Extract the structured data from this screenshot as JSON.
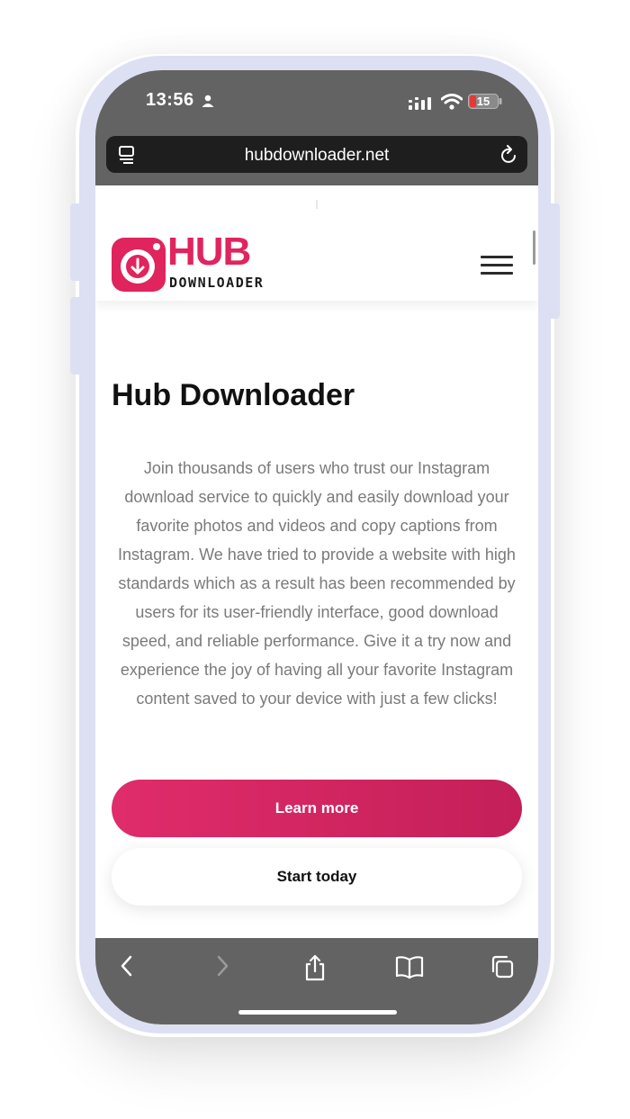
{
  "status_bar": {
    "time": "13:56",
    "battery_level": "15"
  },
  "browser": {
    "url": "hubdownloader.net"
  },
  "site": {
    "logo_main": "HUB",
    "logo_sub": "DOWNLOADER",
    "title": "Hub Downloader",
    "description": "Join thousands of users who trust our Instagram download service to quickly and easily download your favorite photos and videos and copy captions from Instagram. We have tried to provide a website with high standards which as a result has been recommended by users for its user-friendly interface, good download speed, and reliable performance. Give it a try now and experience the joy of having all your favorite Instagram content saved to your device with just a few clicks!",
    "learn_more_label": "Learn more",
    "start_today_label": "Start today"
  },
  "colors": {
    "brand": "#e0245e",
    "browser_chrome": "#636363",
    "url_bar": "#1e1e1e",
    "frame": "#dddff3"
  },
  "icons": [
    "person-icon",
    "cellular-signal-icon",
    "wifi-icon",
    "battery-icon",
    "tab-overview-icon",
    "reload-icon",
    "download-icon",
    "hamburger-menu-icon",
    "back-icon",
    "forward-icon",
    "share-icon",
    "bookmarks-icon",
    "tabs-icon"
  ]
}
